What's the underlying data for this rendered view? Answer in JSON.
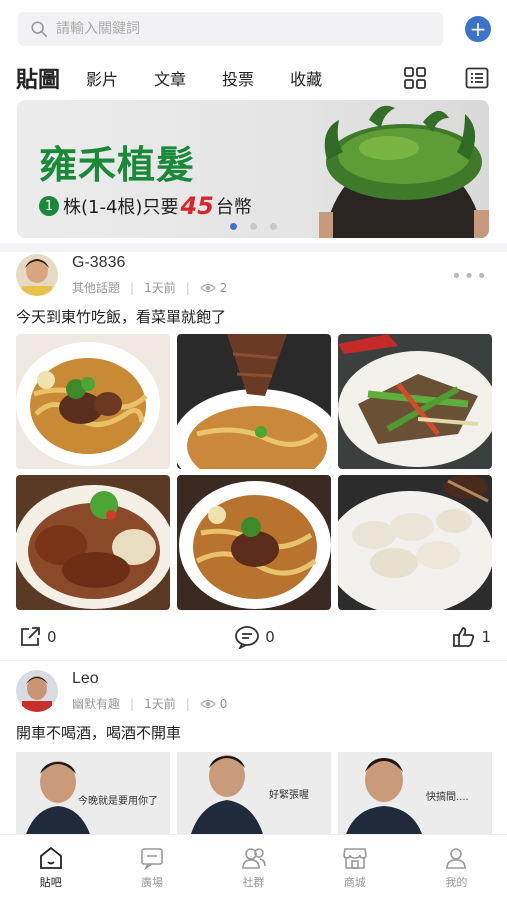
{
  "search": {
    "placeholder": "請輸入關鍵詞"
  },
  "tabs": [
    {
      "label": "貼圖",
      "active": true
    },
    {
      "label": "影片"
    },
    {
      "label": "文章"
    },
    {
      "label": "投票"
    },
    {
      "label": "收藏"
    }
  ],
  "banner": {
    "title": "雍禾植髮",
    "sub_prefix": "株(1-4根)只要",
    "sub_price": "45",
    "sub_suffix": "台幣",
    "page_count": 3,
    "active_page": 1
  },
  "posts": [
    {
      "username": "G-3836",
      "topic": "其他話題",
      "time": "1天前",
      "views": "2",
      "text": "今天到東竹吃飯，看菜單就飽了",
      "share_count": "0",
      "comment_count": "0",
      "like_count": "1"
    },
    {
      "username": "Leo",
      "topic": "幽默有趣",
      "time": "1天前",
      "views": "0",
      "text": "開車不喝酒，喝酒不開車",
      "photo_captions": [
        "今晚就是要用你了",
        "好緊張喔",
        "快搞間...."
      ]
    }
  ],
  "bottom_nav": [
    {
      "label": "貼吧",
      "icon": "home-icon",
      "active": true
    },
    {
      "label": "廣場",
      "icon": "chat-square-icon"
    },
    {
      "label": "社群",
      "icon": "group-icon"
    },
    {
      "label": "商城",
      "icon": "shop-icon"
    },
    {
      "label": "我的",
      "icon": "user-icon"
    }
  ],
  "colors": {
    "accent": "#3b73c8",
    "banner_green": "#1a8a3a",
    "price_red": "#d7262b"
  }
}
